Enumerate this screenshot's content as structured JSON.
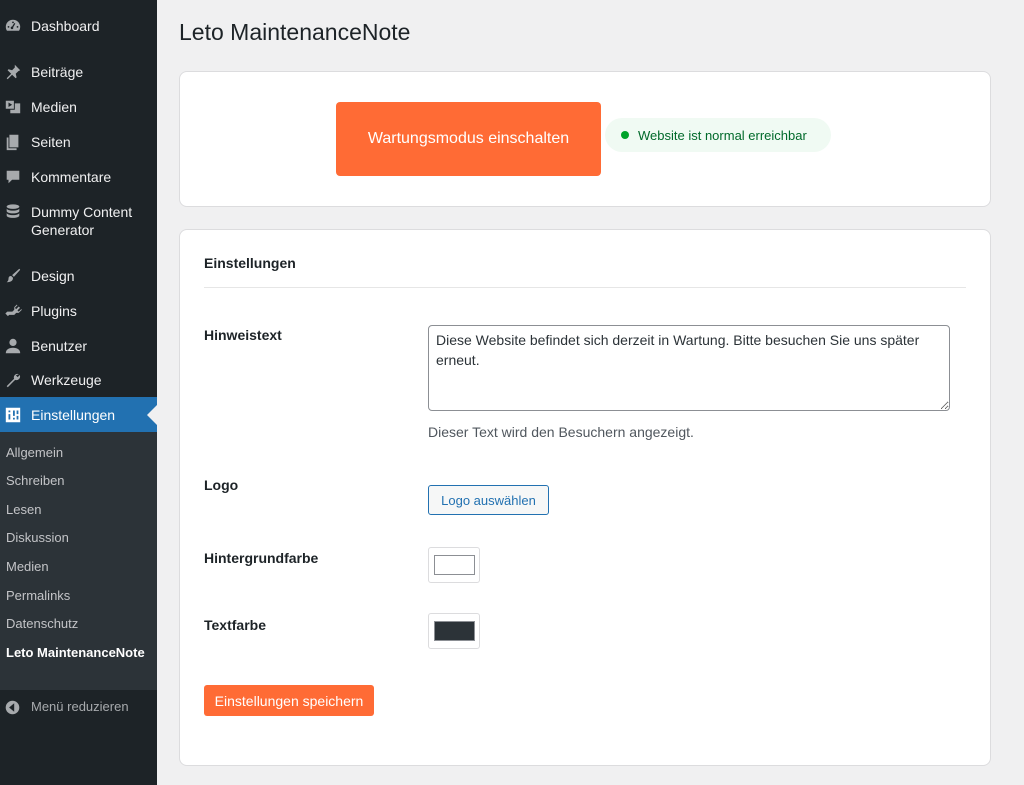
{
  "sidebar": {
    "items": [
      {
        "label": "Dashboard",
        "icon": "dashboard-icon"
      },
      {
        "label": "Beiträge",
        "icon": "pushpin-icon"
      },
      {
        "label": "Medien",
        "icon": "media-icon"
      },
      {
        "label": "Seiten",
        "icon": "pages-icon"
      },
      {
        "label": "Kommentare",
        "icon": "comments-icon"
      },
      {
        "label": "Dummy Content Generator",
        "icon": "database-icon"
      },
      {
        "label": "Design",
        "icon": "brush-icon"
      },
      {
        "label": "Plugins",
        "icon": "plugin-icon"
      },
      {
        "label": "Benutzer",
        "icon": "user-icon"
      },
      {
        "label": "Werkzeuge",
        "icon": "wrench-icon"
      },
      {
        "label": "Einstellungen",
        "icon": "settings-icon",
        "active": true
      }
    ],
    "submenu": [
      {
        "label": "Allgemein"
      },
      {
        "label": "Schreiben"
      },
      {
        "label": "Lesen"
      },
      {
        "label": "Diskussion"
      },
      {
        "label": "Medien"
      },
      {
        "label": "Permalinks"
      },
      {
        "label": "Datenschutz"
      },
      {
        "label": "Leto MaintenanceNote",
        "current": true
      }
    ],
    "collapse_label": "Menü reduzieren"
  },
  "page": {
    "title": "Leto MaintenanceNote"
  },
  "maintenance": {
    "button_label": "Wartungsmodus einschalten",
    "status_text": "Website ist normal erreichbar",
    "status_color": "#00a32a"
  },
  "settings": {
    "section_title": "Einstellungen",
    "notice_label": "Hinweistext",
    "notice_value": "Diese Website befindet sich derzeit in Wartung. Bitte besuchen Sie uns später erneut.",
    "notice_help": "Dieser Text wird den Besuchern angezeigt.",
    "logo_label": "Logo",
    "logo_button": "Logo auswählen",
    "bg_color_label": "Hintergrundfarbe",
    "bg_color_value": "#ffffff",
    "text_color_label": "Textfarbe",
    "text_color_value": "#2c3338",
    "save_button": "Einstellungen speichern"
  },
  "colors": {
    "accent": "#ff6b35",
    "sidebar_bg": "#1d2327",
    "sidebar_active": "#2271b1"
  }
}
